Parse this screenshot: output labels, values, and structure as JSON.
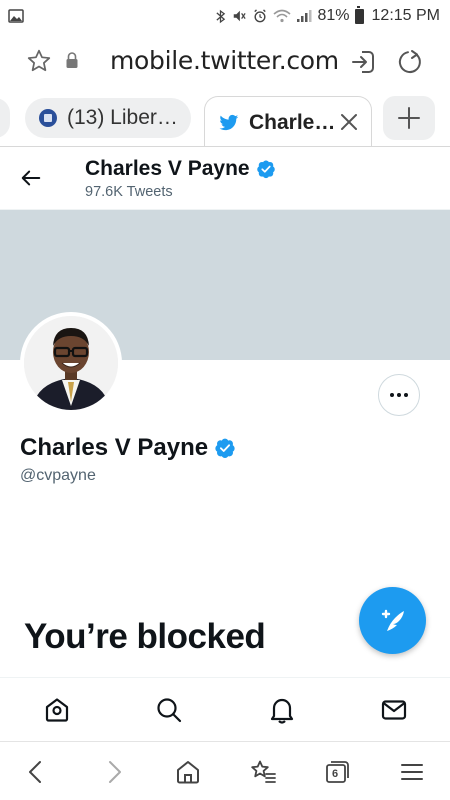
{
  "status_bar": {
    "battery_percent": "81%",
    "time": "12:15 PM",
    "icons": [
      "gallery-icon",
      "bluetooth-icon",
      "mute-icon",
      "alarm-icon",
      "wifi-icon",
      "signal-icon",
      "battery-icon"
    ]
  },
  "browser": {
    "url": "mobile.twitter.com",
    "tabs": [
      {
        "label": "(13) Liber…",
        "favicon": "gov-seal-icon",
        "active": false
      },
      {
        "label": "Charle…",
        "favicon": "twitter-bird-icon",
        "active": true
      }
    ],
    "open_tabs_count": "6",
    "bottom_icons": [
      "back-icon",
      "forward-icon",
      "home-icon",
      "bookmarks-icon",
      "tabs-icon",
      "menu-icon"
    ]
  },
  "profile": {
    "header_name": "Charles V Payne",
    "tweet_count": "97.6K Tweets",
    "display_name": "Charles V Payne",
    "handle": "@cvpayne",
    "verified": true
  },
  "blocked": {
    "title": "You’re blocked"
  },
  "twitter_nav": {
    "icons": [
      "home-icon",
      "search-icon",
      "notifications-icon",
      "messages-icon"
    ]
  },
  "colors": {
    "accent": "#1d9bf0",
    "banner": "#cfd9de",
    "text_primary": "#0f1419",
    "text_secondary": "#536471"
  }
}
